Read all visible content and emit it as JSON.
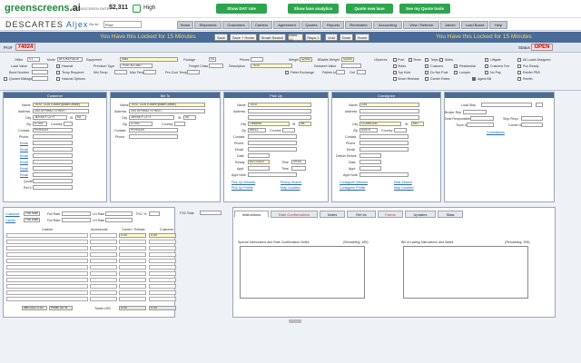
{
  "topbar": {
    "logo": "greenscreens",
    "logo_suffix": ".ai",
    "rate_label": "GREENSCREEN RATE",
    "rate_value": "$2,311",
    "confidence": "High",
    "btn_dat": "Show DAT rate",
    "btn_analytics": "Show lane analytics",
    "btn_quote": "Quote new lane",
    "btn_tools": "See my Quote tools"
  },
  "nav": {
    "brand_a": "DESCARTES",
    "brand_b": "Aljex",
    "goto_label": "Go to:",
    "goto_value": "Pro#",
    "tabs": [
      "Home",
      "Shipments",
      "Customers",
      "Carriers",
      "Agreement",
      "Quotes",
      "Reports",
      "Reminders",
      "Accounting",
      "View / Refresh",
      "Admin",
      "Load Board",
      "Help"
    ]
  },
  "lockbar": {
    "msg_left": "You Have this Locked for 15 Minutes",
    "msg_right": "You Have this Locked for 15 Minutes",
    "buttons": [
      "Save",
      "Save + Home",
      "Smart Search",
      "Docs (1)",
      "Stops 1",
      "Void",
      "Done",
      "Home"
    ]
  },
  "pro": {
    "label": "Pro#",
    "number": "74024",
    "status_label": "Status",
    "status": "OPEN"
  },
  "details": {
    "office_label": "Office",
    "office_value": "V1",
    "mode_label": "Mode",
    "mode_value": "BROKERAGE",
    "equipment_label": "Equipment",
    "equipment_value": "VAN",
    "footage_label": "Footage",
    "footage_value": "53",
    "pieces_label": "Pieces",
    "pieces_value": "",
    "weight_label": "Weight",
    "weight_value": "42000",
    "bill_weight_label": "Billable Weight",
    "bill_weight_value": "42000",
    "lf_label": "Lf/pieces",
    "load_value_label": "Load Value",
    "hazmat_label": "Hazmat",
    "premium_label": "Premium Type",
    "premium_value": "TRUCKLOAD",
    "freight_class_label": "Freight Class",
    "description_label": "Description",
    "description_value": "TEST",
    "declared_label": "Declared Value",
    "bond_label": "Bond Number",
    "temp_label": "Temp Required",
    "min_temp_label": "Min Temp",
    "max_temp_label": "Max Temp",
    "pre_cool_label": "Pre-Cool Temp",
    "pallet_label": "Pallet Exchange",
    "pallets_to_label": "Pallets to",
    "out_label": "Out",
    "quoted_label": "Quoted Mileage",
    "options": [
      "Post",
      "Team",
      "Tarps",
      "Sides",
      "Residential",
      "Tarps Side",
      "Liftgate",
      "Reefer",
      "All Loads Assigned",
      "Customs",
      "Customs Fee",
      "Pcs Ready",
      "Gov Spot Reefer",
      "Top Hold",
      "Do Not Post",
      "Lumper",
      "No Pay",
      "Reefer PBS"
    ],
    "smart_release_label": "Smart Release",
    "carrier_rates_label": "Carrier Rates",
    "hazmat_options_label": "Hazmat Options",
    "agent_bill_label": "Agent Bill"
  },
  "customer": {
    "header": "Customer",
    "name_label": "Name",
    "name_value": "TEST CUSTOMER(Main Office)",
    "address_label": "Address",
    "address_value": "200 SPRING STREET",
    "city_label": "City",
    "city_value": "JERSEY CITY",
    "st_label": "St",
    "st_value": "NJ",
    "zip_label": "Zip",
    "zip_value": "07302",
    "country_label": "Country",
    "contact_label": "Contact",
    "contact_value": "PERSON",
    "phone_label": "Phone",
    "fax_label": "Fax",
    "email_label": "Email",
    "ref_label": "Ref #",
    "quote_label": "Quote"
  },
  "billto": {
    "header": "Bill To",
    "name_label": "Name",
    "name_value": "TEST CUSTOMER(Main Office)",
    "address_label": "Address",
    "address_value": "200 SPRING STREET",
    "city_label": "City",
    "city_value": "JERSEY CITY",
    "st_label": "St",
    "st_value": "NJ",
    "zip_label": "Zip",
    "zip_value": "07302",
    "country_label": "Country",
    "contact_label": "Contact",
    "contact_value": "PERSON",
    "phone_label": "Phone"
  },
  "pickup": {
    "header": "Pick Up",
    "name_label": "Name",
    "name_value": "TEST",
    "address_label": "Address",
    "city_label": "City",
    "city_value": "OMAHA",
    "st_label": "St",
    "st_value": "NE",
    "zip_label": "Zip",
    "zip_value": "68111",
    "country_label": "Country",
    "contact_label": "Contact",
    "phone_label": "Phone",
    "email_label": "Email",
    "date_label": "Date",
    "ready_label": "Ready",
    "ready_value": "6/27/2023",
    "time_label": "Time",
    "time_value": "09:00",
    "appt_label": "Appt",
    "appt_note_label": "Appt Note",
    "links": [
      "Pick Up Window",
      "Pickup Search",
      "Pick Up Profile",
      "Map Location"
    ]
  },
  "consignee": {
    "header": "Consignee",
    "name_label": "Name",
    "name_value": "234",
    "address_label": "Address",
    "city_label": "City",
    "city_value": "CLARIDGE",
    "st_label": "St",
    "st_value": "MO",
    "zip_label": "Zip",
    "zip_value": "63475",
    "country_label": "Country",
    "contact_label": "Contact",
    "phone_label": "Phone",
    "email_label": "Email",
    "date_label": "Date",
    "deliver_label": "Deliver Before",
    "appt_label": "Appt",
    "appt_note_label": "Appt Note",
    "links": [
      "Consignee Window",
      "Dest Search",
      "Consignee Profile",
      "Map Location"
    ]
  },
  "carrier": {
    "load_label": "Load Step",
    "broker_label": "Broker Rep",
    "dest_resp_label": "Dest Responsible",
    "truck_label": "Truck #",
    "ship_label": "Ship Resp.",
    "carrier_label": "Carrier #",
    "commission_label": "Commission",
    "dispatch_label": "Dispatch Rep"
  },
  "charges": {
    "customer_label": "Customer",
    "carrier_label": "Carrier",
    "flat_rate": "Flat Rate",
    "full_rate": "Full Rate",
    "lh_label": "LH Rate",
    "fsc_label": "FSC %",
    "fsc_rate_label": "FSC Rate",
    "col_cashier": "Cashier",
    "col_accessorial": "Accessorial",
    "col_carrier_rebate": "Carrier / Rebate",
    "col_customer": "Customer",
    "val_carrier": "0.00",
    "val_customer": "0.00",
    "net_label": "Net USD 0.00",
    "profit_label": "Profit: 00 %",
    "totals_label": "Totals USD",
    "totals_val": "0.00",
    "totals_val2": "0.00"
  },
  "tabs_bottom": [
    "Instructions",
    "Rate Confirmations",
    "Notes",
    "Ref #s",
    "Forms",
    "Updates",
    "Stats"
  ],
  "instructions": {
    "special_label": "Special Instructions and Rate Confirmation Notes",
    "special_remaining": "(Remaining: 185)",
    "bol_label": "Bill of Lading Instructions and Notes",
    "bol_remaining": "(Remaining: 255)"
  }
}
